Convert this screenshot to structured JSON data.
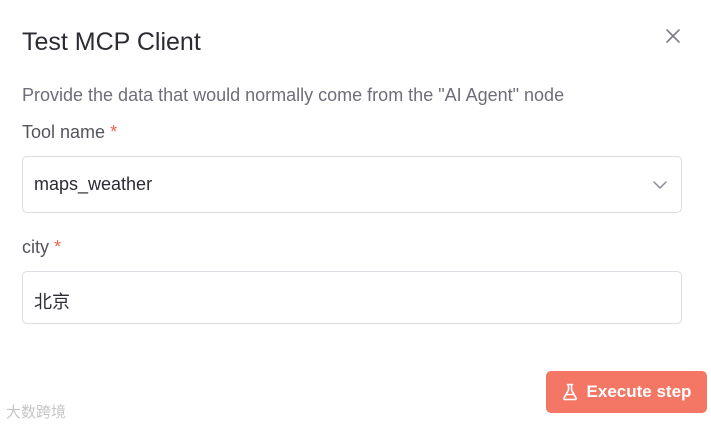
{
  "dialog": {
    "title": "Test MCP Client",
    "description": "Provide the data that would normally come from the \"AI Agent\" node"
  },
  "tool_name_field": {
    "label": "Tool name",
    "required_marker": "*",
    "value": "maps_weather"
  },
  "city_field": {
    "label": "city",
    "required_marker": "*",
    "value": "北京"
  },
  "execute_button": {
    "label": "Execute step"
  },
  "watermark": {
    "text": "大数跨境"
  },
  "icons": {
    "close": "close-icon",
    "chevron": "chevron-down-icon",
    "flask": "flask-icon"
  },
  "colors": {
    "accent": "#f47766",
    "required": "#e8654d"
  }
}
